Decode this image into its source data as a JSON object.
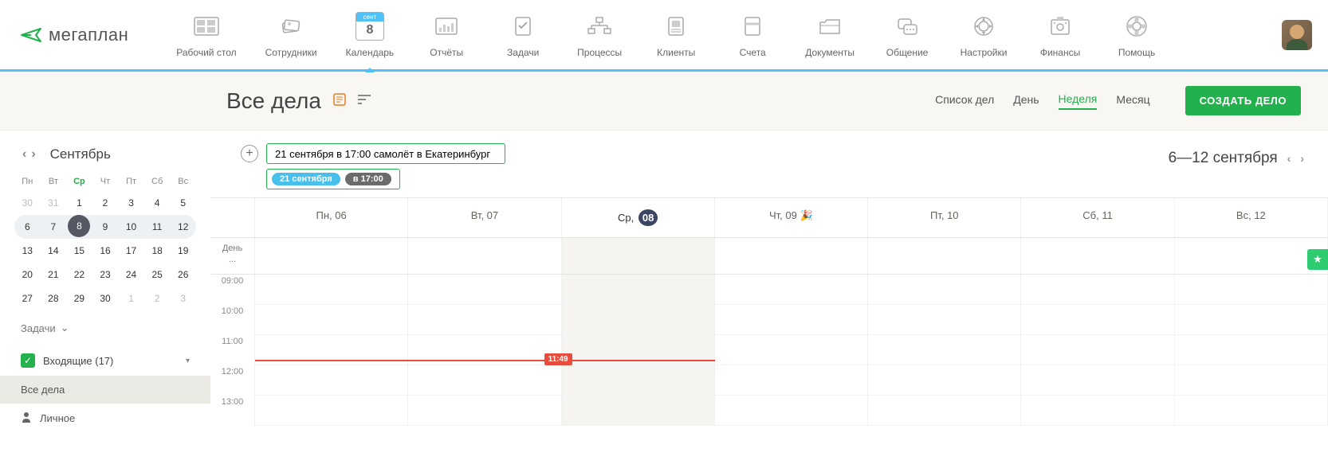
{
  "brand": "мегаплан",
  "nav": [
    {
      "label": "Рабочий стол"
    },
    {
      "label": "Сотрудники"
    },
    {
      "label": "Календарь",
      "active": true,
      "badge": "сент",
      "day": "8"
    },
    {
      "label": "Отчёты"
    },
    {
      "label": "Задачи"
    },
    {
      "label": "Процессы"
    },
    {
      "label": "Клиенты"
    },
    {
      "label": "Счета"
    },
    {
      "label": "Документы"
    },
    {
      "label": "Общение"
    },
    {
      "label": "Настройки"
    },
    {
      "label": "Финансы"
    },
    {
      "label": "Помощь"
    }
  ],
  "page_title": "Все дела",
  "views": {
    "list": "Список дел",
    "day": "День",
    "week": "Неделя",
    "month": "Месяц"
  },
  "create_btn": "СОЗДАТЬ ДЕЛО",
  "sidebar": {
    "month": "Сентябрь",
    "dow": [
      "Пн",
      "Вт",
      "Ср",
      "Чт",
      "Пт",
      "Сб",
      "Вс"
    ],
    "weeks": [
      [
        "30",
        "31",
        "1",
        "2",
        "3",
        "4",
        "5"
      ],
      [
        "6",
        "7",
        "8",
        "9",
        "10",
        "11",
        "12"
      ],
      [
        "13",
        "14",
        "15",
        "16",
        "17",
        "18",
        "19"
      ],
      [
        "20",
        "21",
        "22",
        "23",
        "24",
        "25",
        "26"
      ],
      [
        "27",
        "28",
        "29",
        "30",
        "1",
        "2",
        "3"
      ]
    ],
    "tasks_label": "Задачи",
    "inbox": "Входящие (17)",
    "cat_all": "Все дела",
    "cat_personal": "Личное"
  },
  "quick_add": {
    "value": "21 сентября в 17:00 самолёт в Екатеринбург",
    "tag_date": "21 сентября",
    "tag_time": "в 17:00"
  },
  "range": "6—12 сентября",
  "week_days": [
    {
      "lbl": "Пн, 06"
    },
    {
      "lbl": "Вт, 07"
    },
    {
      "lbl": "Ср,",
      "day": "08",
      "today": true
    },
    {
      "lbl": "Чт, 09",
      "emoji": "🎉"
    },
    {
      "lbl": "Пт, 10"
    },
    {
      "lbl": "Сб, 11"
    },
    {
      "lbl": "Вс, 12"
    }
  ],
  "all_day": "День\n...",
  "hours": [
    "09:00",
    "10:00",
    "11:00",
    "12:00",
    "13:00"
  ],
  "now": "11:49"
}
